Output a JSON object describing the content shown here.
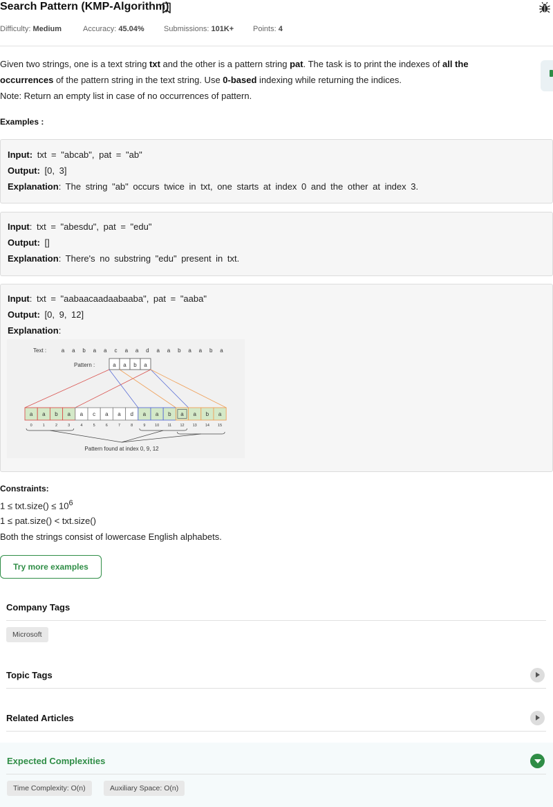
{
  "problem": {
    "title": "Search Pattern (KMP-Algorithm)",
    "difficulty_label": "Difficulty:",
    "difficulty": "Medium",
    "accuracy_label": "Accuracy:",
    "accuracy": "45.04%",
    "submissions_label": "Submissions:",
    "submissions": "101K+",
    "points_label": "Points:",
    "points": "4"
  },
  "description": {
    "p1_a": "Given two strings, one is a text string ",
    "p1_b": "txt",
    "p1_c": " and the other is a pattern string ",
    "p1_d": "pat",
    "p1_e": ". The task is to print the indexes of ",
    "p1_f": "all the",
    "p2_a": "occurrences",
    "p2_b": " of the pattern string in the text string. Use ",
    "p2_c": "0-based",
    "p2_d": " indexing while returning the indices.",
    "note": "Note: Return an empty list in case of no occurrences of pattern.",
    "examples_heading": "Examples :"
  },
  "examples": [
    {
      "input_label": "Input:",
      "input": " txt = \"abcab\", pat = \"ab\"",
      "output_label": "Output:",
      "output": " [0, 3]",
      "explanation_label": "Explanation",
      "explanation": ": The string \"ab\" occurs twice in txt, one starts at index 0 and the other at index 3."
    },
    {
      "input_label": "Input",
      "input": ": txt = \"abesdu\", pat = \"edu\"",
      "output_label": "Output:",
      "output": " []",
      "explanation_label": "Explanation",
      "explanation": ": There's no substring \"edu\" present in txt."
    },
    {
      "input_label": "Input",
      "input": ": txt = \"aabaacaadaabaaba\", pat = \"aaba\"",
      "output_label": "Output:",
      "output": " [0, 9, 12]",
      "explanation_label": "Explanation",
      "explanation": ":"
    }
  ],
  "diagram": {
    "text_label": "Text :",
    "text_chars": [
      "a",
      "a",
      "b",
      "a",
      "a",
      "c",
      "a",
      "a",
      "d",
      "a",
      "a",
      "b",
      "a",
      "a",
      "b",
      "a"
    ],
    "pattern_label": "Pattern :",
    "pattern_chars": [
      "a",
      "a",
      "b",
      "a"
    ],
    "indices": [
      "0",
      "1",
      "2",
      "3",
      "4",
      "5",
      "6",
      "7",
      "8",
      "9",
      "10",
      "11",
      "12",
      "13",
      "14",
      "15"
    ],
    "caption": "Pattern found at index 0, 9, 12",
    "colors": {
      "red": "#d9534f",
      "blue": "#5b6fd6",
      "orange": "#f0a15a",
      "green_fill": "#d4e9c8",
      "text": "#333333"
    }
  },
  "constraints": {
    "heading": "Constraints:",
    "line1_a": "1 ≤ txt.size() ≤ 10",
    "line1_exp": "6",
    "line2": "1 ≤ pat.size() < txt.size()",
    "line3": "Both the strings consist of lowercase English alphabets."
  },
  "try_button": "Try more examples",
  "company_tags": {
    "title": "Company Tags",
    "tags": [
      "Microsoft"
    ]
  },
  "topic_tags": {
    "title": "Topic Tags"
  },
  "related_articles": {
    "title": "Related Articles"
  },
  "expected_complexities": {
    "title": "Expected Complexities",
    "time": "Time Complexity: O(n)",
    "space": "Auxiliary Space: O(n)"
  },
  "icons": {
    "bookmark": "bookmark-icon",
    "bug": "bug-icon",
    "chevron_right": "chevron-right-icon",
    "chevron_down": "chevron-down-icon"
  },
  "accent_color": "#2f8d46"
}
